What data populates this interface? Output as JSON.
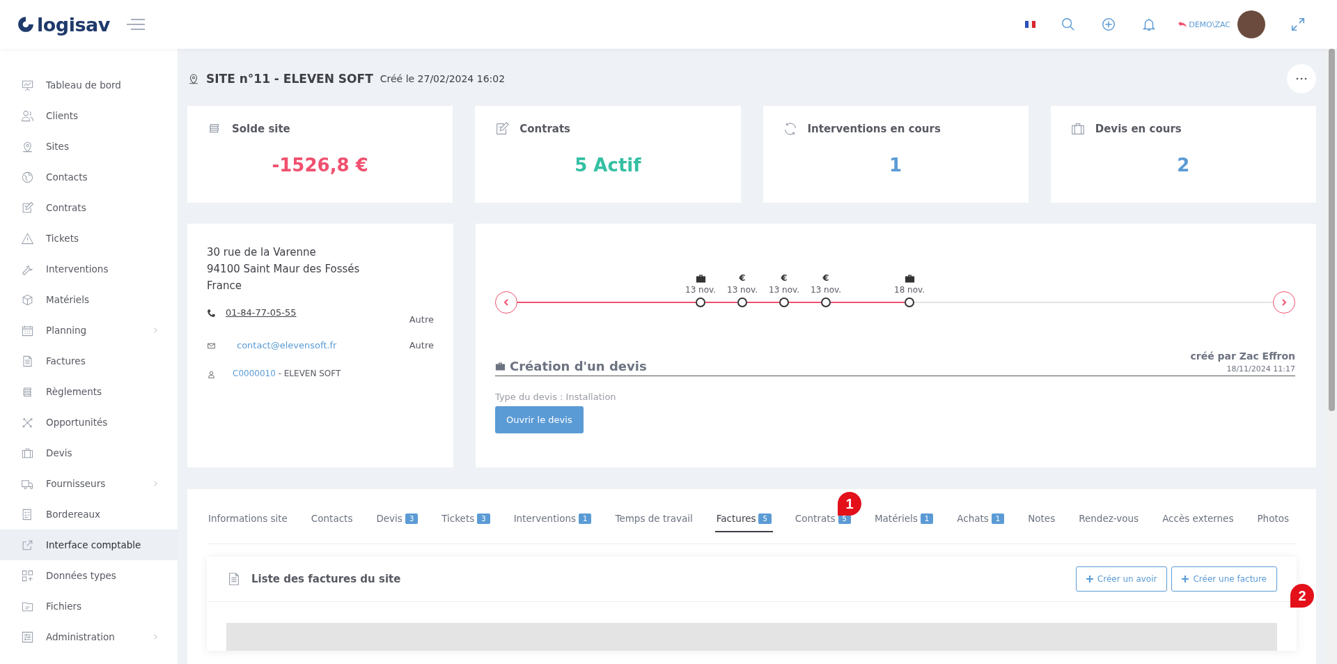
{
  "header": {
    "logo_text": "logisav",
    "user_label": "DEMO\\ZAC"
  },
  "sidebar": {
    "items": [
      {
        "label": "Tableau de bord",
        "expandable": false,
        "selected": false
      },
      {
        "label": "Clients",
        "expandable": false,
        "selected": false
      },
      {
        "label": "Sites",
        "expandable": false,
        "selected": false
      },
      {
        "label": "Contacts",
        "expandable": false,
        "selected": false
      },
      {
        "label": "Contrats",
        "expandable": false,
        "selected": false
      },
      {
        "label": "Tickets",
        "expandable": false,
        "selected": false
      },
      {
        "label": "Interventions",
        "expandable": false,
        "selected": false
      },
      {
        "label": "Matériels",
        "expandable": false,
        "selected": false
      },
      {
        "label": "Planning",
        "expandable": true,
        "selected": false
      },
      {
        "label": "Factures",
        "expandable": false,
        "selected": false
      },
      {
        "label": "Règlements",
        "expandable": false,
        "selected": false
      },
      {
        "label": "Opportunités",
        "expandable": false,
        "selected": false
      },
      {
        "label": "Devis",
        "expandable": false,
        "selected": false
      },
      {
        "label": "Fournisseurs",
        "expandable": true,
        "selected": false
      },
      {
        "label": "Bordereaux",
        "expandable": false,
        "selected": false
      },
      {
        "label": "Interface comptable",
        "expandable": false,
        "selected": true
      },
      {
        "label": "Données types",
        "expandable": false,
        "selected": false
      },
      {
        "label": "Fichiers",
        "expandable": false,
        "selected": false
      },
      {
        "label": "Administration",
        "expandable": true,
        "selected": false
      }
    ]
  },
  "page": {
    "title": "SITE n°11 - ELEVEN SOFT",
    "created": "Créé le 27/02/2024 16:02"
  },
  "stats": [
    {
      "title": "Solde site",
      "value": "-1526,8 €",
      "color": "#f0506e"
    },
    {
      "title": "Contrats",
      "value": "5 Actif",
      "color": "#34bfa3"
    },
    {
      "title": "Interventions en cours",
      "value": "1",
      "color": "#5b9bd5"
    },
    {
      "title": "Devis en cours",
      "value": "2",
      "color": "#5b9bd5"
    }
  ],
  "address": {
    "lines": [
      "30 rue de la Varenne",
      "94100 Saint Maur des Fossés",
      "France"
    ],
    "phone": "01-84-77-05-55",
    "phone_type": "Autre",
    "email": "contact@elevensoft.fr",
    "email_type": "Autre",
    "client_code": "C0000010",
    "client_name": " - ELEVEN SOFT"
  },
  "timeline": {
    "events": [
      {
        "kind": "briefcase",
        "date": "13 nov."
      },
      {
        "kind": "symbol",
        "symbol": "€",
        "date": "13 nov."
      },
      {
        "kind": "symbol",
        "symbol": "€",
        "date": "13 nov."
      },
      {
        "kind": "symbol",
        "symbol": "€",
        "date": "13 nov."
      },
      {
        "kind": "briefcase",
        "date": "18 nov."
      }
    ],
    "detail": {
      "title": "Création d'un devis",
      "author": "créé par Zac Effron",
      "datetime": "18/11/2024 11:17",
      "type": "Type du devis : Installation",
      "button": "Ouvrir le devis"
    }
  },
  "tabs": [
    {
      "label": "Informations site",
      "selected": false
    },
    {
      "label": "Contacts",
      "selected": false
    },
    {
      "label": "Devis",
      "count": "3",
      "selected": false
    },
    {
      "label": "Tickets",
      "count": "3",
      "selected": false
    },
    {
      "label": "Interventions",
      "count": "1",
      "selected": false
    },
    {
      "label": "Temps de travail",
      "selected": false
    },
    {
      "label": "Factures",
      "count": "5",
      "selected": true
    },
    {
      "label": "Contrats",
      "count": "5",
      "selected": false
    },
    {
      "label": "Matériels",
      "count": "1",
      "selected": false
    },
    {
      "label": "Achats",
      "count": "1",
      "selected": false
    },
    {
      "label": "Notes",
      "selected": false
    },
    {
      "label": "Rendez-vous",
      "selected": false
    },
    {
      "label": "Accès externes",
      "selected": false
    },
    {
      "label": "Photos",
      "selected": false
    }
  ],
  "invoices": {
    "title": "Liste des factures du site",
    "buttons": [
      "Créer un avoir",
      "Créer une facture"
    ]
  },
  "annotations": [
    {
      "label": "1"
    },
    {
      "label": "2"
    }
  ]
}
